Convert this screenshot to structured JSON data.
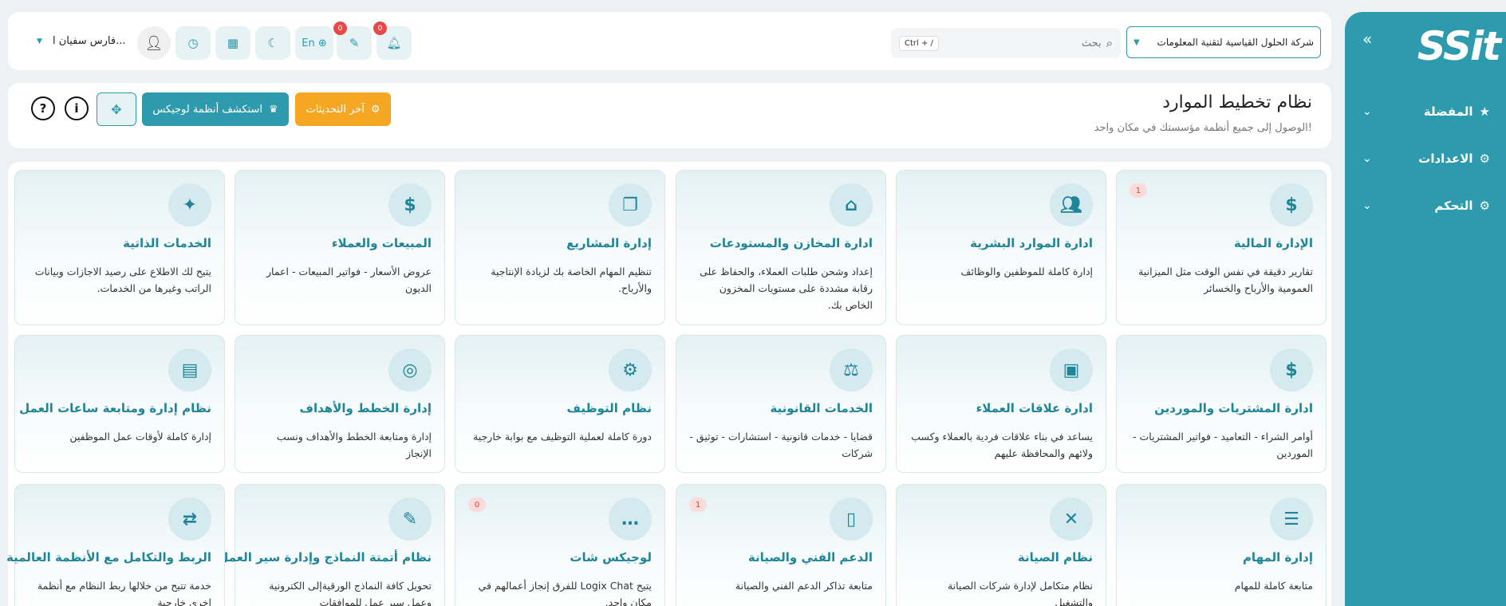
{
  "sidebar": {
    "logo": "SSit",
    "collapse_icon": "double-chevron-icon",
    "items": [
      {
        "label": "المفضلة",
        "icon": "star-icon"
      },
      {
        "label": "الاعدادات",
        "icon": "gear-icon"
      },
      {
        "label": "التحكم",
        "icon": "gears-icon"
      }
    ]
  },
  "topbar": {
    "company": "شركة الحلول القياسية لتقنية المعلومات",
    "search_placeholder": "بحث",
    "search_shortcut": "Ctrl + /",
    "notifications_count": "0",
    "tasks_count": "0",
    "language": "En",
    "user_name": "فارس سفيان ا..."
  },
  "header": {
    "title": "نظام تخطيط الموارد",
    "subtitle": "الوصول إلى جميع أنظمة مؤسستك في مكان واحد!",
    "updates_label": "آخر التحديثات",
    "explore_label": "استكشف أنظمة لوجيكس"
  },
  "cards": [
    {
      "title": "الإدارة المالية",
      "desc": "تقارير دقيقة في نفس الوقت مثل الميزانية العمومية والأرباح والخسائر",
      "icon": "dollar-icon",
      "badge": "1"
    },
    {
      "title": "ادارة الموارد البشرية",
      "desc": "إدارة كاملة للموظفين والوظائف",
      "icon": "users-icon",
      "badge": ""
    },
    {
      "title": "ادارة المخازن والمستودعات",
      "desc": "إعداد وشحن طلبات العملاء، والحفاظ على رقابة مشددة على مستويات المخزون الخاص بك.",
      "icon": "warehouse-icon",
      "badge": ""
    },
    {
      "title": "إدارة المشاريع",
      "desc": "تنظيم المهام الخاصة بك لزيادة الإنتاجية والأرباح.",
      "icon": "project-file-icon",
      "badge": ""
    },
    {
      "title": "المبيعات والعملاء",
      "desc": "عروض الأسعار - فواتير المبيعات - اعمار الديون",
      "icon": "sales-chat-icon",
      "badge": ""
    },
    {
      "title": "الخدمات الذاتية",
      "desc": "يتيح لك الاطلاع على رصيد الاجازات وبيانات الراتب وغيرها من الخدمات.",
      "icon": "person-sparkle-icon",
      "badge": ""
    },
    {
      "title": "ادارة المشتريات والموردين",
      "desc": "أوامر الشراء - التعاميد - فواتير المشتريات - الموردين",
      "icon": "money-box-icon",
      "badge": ""
    },
    {
      "title": "ادارة علاقات العملاء",
      "desc": "يساعد في بناء علاقات فردية بالعملاء وكسب ولائهم والمحافظة عليهم",
      "icon": "crm-board-icon",
      "badge": ""
    },
    {
      "title": "الخدمات القانونية",
      "desc": "قضايا - خدمات قانونية - استشارات - توثيق - شركات",
      "icon": "scales-icon",
      "badge": ""
    },
    {
      "title": "نظام التوظيف",
      "desc": "دورة كاملة لعملية التوظيف مع بوابة خارجية",
      "icon": "user-gear-icon",
      "badge": ""
    },
    {
      "title": "إدارة الخطط والأهداف",
      "desc": "إدارة ومتابعة الخطط والأهداف ونسب الإنجاز",
      "icon": "target-icon",
      "badge": ""
    },
    {
      "title": "نظام إدارة ومتابعة ساعات العمل",
      "desc": "إدارة كاملة لأوقات عمل الموظفين",
      "icon": "briefcase-icon",
      "badge": ""
    },
    {
      "title": "إدارة المهام",
      "desc": "متابعة كاملة للمهام",
      "icon": "task-list-icon",
      "badge": ""
    },
    {
      "title": "نظام الصيانة",
      "desc": "نظام متكامل لإدارة شركات الصيانة والتشغيل",
      "icon": "tools-icon",
      "badge": ""
    },
    {
      "title": "الدعم الفني والصيانة",
      "desc": "متابعة تذاكر الدعم الفني والصيانة",
      "icon": "tablet-icon",
      "badge": "1"
    },
    {
      "title": "لوجيكس شات",
      "desc": "يتيح Logix Chat للفرق إنجاز أعمالهم في مكان واحد.",
      "icon": "chat-bubble-icon",
      "badge": "0"
    },
    {
      "title": "نظام أتمتة النماذج وإدارة سير العمل",
      "desc": "تحويل كافة النماذج الورقيةإلى الكترونية وعمل سير عمل للموافقات",
      "icon": "form-edit-icon",
      "badge": ""
    },
    {
      "title": "الربط والتكامل مع الأنظمة العالمية",
      "desc": "خدمة تتيح من خلالها ربط النظام مع أنظمة اخرى خارجية",
      "icon": "integration-icon",
      "badge": ""
    }
  ]
}
